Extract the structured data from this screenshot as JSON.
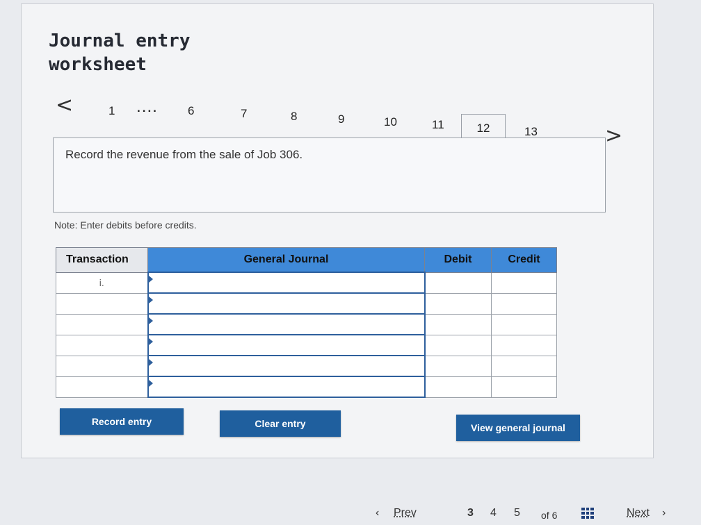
{
  "header": {
    "title_line1": "Journal entry",
    "title_line2": "worksheet"
  },
  "tabs": {
    "prev_arrow": "<",
    "next_arrow": ">",
    "items": [
      "1",
      "....",
      "6",
      "7",
      "8",
      "9",
      "10",
      "11",
      "12",
      "13"
    ],
    "active": "12"
  },
  "instruction": "Record the revenue from the sale of Job 306.",
  "note": "Note: Enter debits before credits.",
  "table": {
    "headers": {
      "transaction": "Transaction",
      "general_journal": "General Journal",
      "debit": "Debit",
      "credit": "Credit"
    },
    "rows": [
      {
        "transaction": "i.",
        "account": "",
        "debit": "",
        "credit": ""
      },
      {
        "transaction": "",
        "account": "",
        "debit": "",
        "credit": ""
      },
      {
        "transaction": "",
        "account": "",
        "debit": "",
        "credit": ""
      },
      {
        "transaction": "",
        "account": "",
        "debit": "",
        "credit": ""
      },
      {
        "transaction": "",
        "account": "",
        "debit": "",
        "credit": ""
      },
      {
        "transaction": "",
        "account": "",
        "debit": "",
        "credit": ""
      }
    ]
  },
  "buttons": {
    "record_entry": "Record entry",
    "clear_entry": "Clear entry",
    "view_general_journal": "View general journal"
  },
  "pagination": {
    "prev": "Prev",
    "pages": [
      "3",
      "4",
      "5"
    ],
    "current": "3",
    "of_total": "of 6",
    "next": "Next"
  },
  "colors": {
    "header_blue": "#3f89d8",
    "button_blue": "#1f5f9e"
  }
}
